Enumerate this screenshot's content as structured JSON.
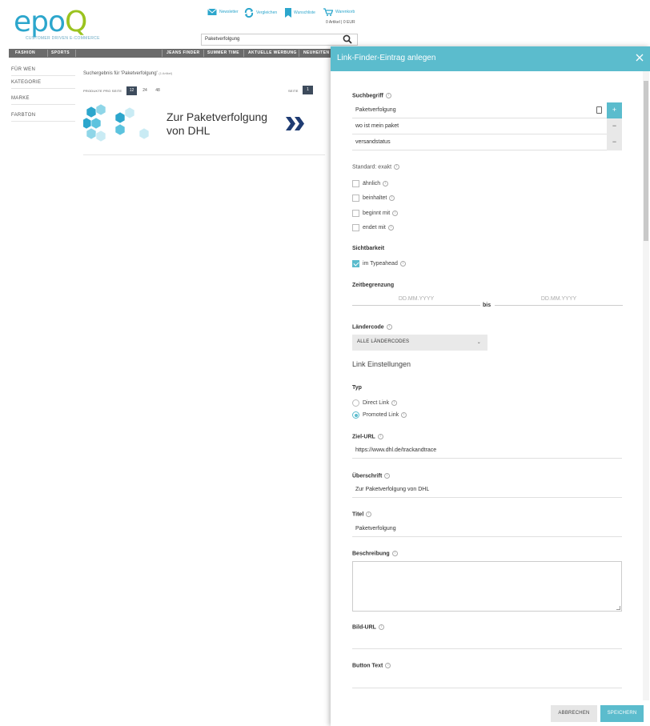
{
  "shop": {
    "logo": {
      "text_main": "epo",
      "text_q": "Q",
      "tagline": "CUSTOMER DRIVEN E-COMMERCE"
    },
    "header_links": [
      "Newsletter",
      "Vergleichen",
      "Wunschliste",
      "Warenkorb"
    ],
    "cart_summary": "0 Artikel | 0 EUR",
    "search_value": "Paketverfolgung",
    "nav_left": [
      "FASHION",
      "SPORTS"
    ],
    "nav_right": [
      "JEANS FINDER",
      "SUMMER TIME",
      "AKTUELLE WERBUNG",
      "NEUHEITEN"
    ],
    "sidebar": [
      "FÜR WEN",
      "KATEGORIE",
      "MARKE",
      "FARBTON"
    ],
    "results_title": "Suchergebnis für 'Paketverfolgung'",
    "results_count": "(1 Artikel)",
    "products_per_page_label": "PRODUKTE PRO SEITE",
    "per_page_options": [
      "12",
      "24",
      "48"
    ],
    "page_label": "SEITE",
    "page_current": "1",
    "banner_text_line1": "Zur Paketverfolgung",
    "banner_text_line2": "von DHL"
  },
  "modal": {
    "title": "Link-Finder-Eintrag anlegen",
    "search_term_label": "Suchbegriff",
    "search_terms": [
      "Paketverfolgung",
      "wo ist mein paket",
      "versandstatus"
    ],
    "add_symbol": "+",
    "remove_symbol": "−",
    "match_default": "Standard: exakt",
    "match_options": [
      "ähnlich",
      "beinhaltet",
      "beginnt mit",
      "endet mit"
    ],
    "visibility_label": "Sichtbarkeit",
    "visibility_option": "im Typeahead",
    "time_limit_label": "Zeitbegrenzung",
    "date_placeholder": "DD.MM.YYYY",
    "date_separator": "bis",
    "country_label": "Ländercode",
    "country_value": "ALLE LÄNDERCODES",
    "link_section": "Link Einstellungen",
    "type_label": "Typ",
    "type_options": [
      "Direct Link",
      "Promoted Link"
    ],
    "type_selected_index": 1,
    "target_url_label": "Ziel-URL",
    "target_url_value": "https://www.dhl.de/trackandtrace",
    "heading_label": "Überschrift",
    "heading_value": "Zur Paketverfolgung von DHL",
    "title_label": "Titel",
    "title_value": "Paketverfolgung",
    "description_label": "Beschreibung",
    "image_url_label": "Bild-URL",
    "button_text_label": "Button Text",
    "cancel_label": "ABBRECHEN",
    "save_label": "SPEICHERN",
    "info_glyph": "i"
  },
  "colors": {
    "accent": "#5bbccd",
    "logo_blue": "#2ca6cc",
    "logo_green": "#9bc31f",
    "nav_gray": "#6b6b6b",
    "page_active": "#3d4b5c",
    "dhl_navy": "#1f3c73"
  }
}
